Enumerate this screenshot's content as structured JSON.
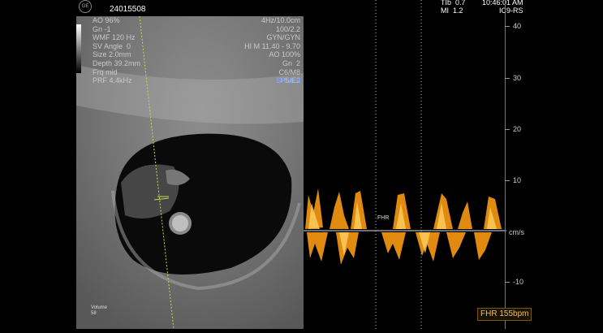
{
  "header": {
    "patient_id": "24015508",
    "logo": "GE",
    "tib": "TIb  0.7\nMI  1.2",
    "time": "10:46:01 AM\nIC9-RS"
  },
  "left_info": "AO 96%\nGn -1\nWMF 120 Hz\nSV Angle  0\nSize 2.0mm\nDepth 39.2mm\nFrq mid\nPRF 4.4kHz",
  "right_info": "4Hz/10.0cm\n100/2.2\nGYN/GYN\nHI M 11.40 - 9.70\nAO 100%\nGn  2\nC6/M8\nP5/E2",
  "sri": "SRI II 4",
  "volume": "Volume\n58",
  "doppler": {
    "axis_labels": [
      "40",
      "30",
      "20",
      "10",
      "-10"
    ],
    "unit": "cm/s",
    "fhr_marker": "FHR",
    "fhr_value": "FHR 155bpm"
  }
}
